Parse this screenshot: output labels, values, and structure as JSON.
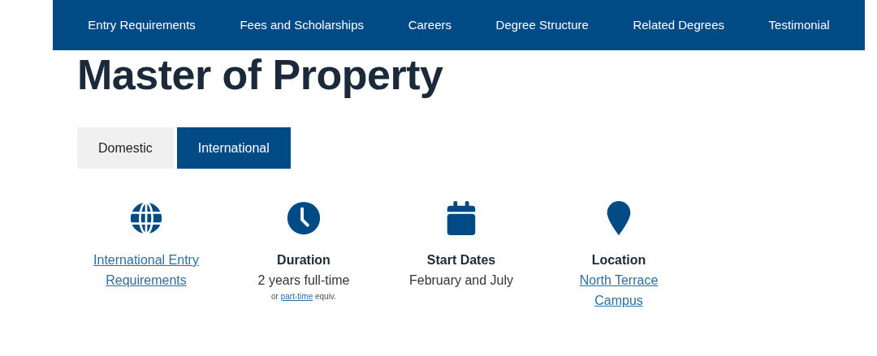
{
  "nav": [
    "Entry Requirements",
    "Fees and Scholarships",
    "Careers",
    "Degree Structure",
    "Related Degrees",
    "Testimonial"
  ],
  "title": "Master of Property",
  "tabs": [
    {
      "label": "Domestic",
      "selected": false
    },
    {
      "label": "International",
      "selected": true
    }
  ],
  "facts": [
    {
      "link": "International Entry Requirements"
    },
    {
      "heading": "Duration",
      "text": "2 years full-time",
      "note": {
        "before": "or",
        "link": "part-time",
        "after": "equiv."
      }
    },
    {
      "heading": "Start Dates",
      "text": "February and July"
    },
    {
      "heading": "Location",
      "link": "North Terrace Campus"
    }
  ]
}
